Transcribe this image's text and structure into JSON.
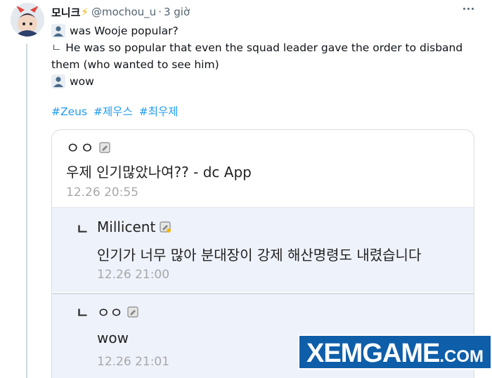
{
  "tweet": {
    "display_name": "모니크",
    "name_emoji": "⚡",
    "handle": "@mochou_u",
    "separator": "·",
    "time": "3 giờ",
    "lines": [
      {
        "icon": "person-icon",
        "text": "was Wooje popular?"
      },
      {
        "mark": "ㄴ",
        "text": "He was so popular that even the squad leader gave the order to disband them (who wanted to see him)"
      },
      {
        "icon": "person-icon",
        "text": "wow"
      }
    ],
    "hashtags": [
      "#Zeus",
      "#제우스",
      "#최우제"
    ]
  },
  "card": {
    "post": {
      "author": "ㅇㅇ",
      "text": "우제 인기많았나여?? - dc App",
      "time": "12.26 20:55"
    },
    "replies": [
      {
        "arrow": "ㄴ",
        "author": "Millicent",
        "text": "인기가 너무 많아 분대장이 강제 해산명령도 내렸습니다",
        "time": "12.26 21:00"
      },
      {
        "arrow": "ㄴ",
        "author": "ㅇㅇ",
        "text": "wow",
        "time": "12.26 21:01"
      }
    ]
  },
  "watermark": {
    "main": "XEMGAME",
    "suffix": ".COM"
  },
  "colors": {
    "link": "#1d9bf0",
    "muted": "#536471",
    "reply_bg": "#eef2fb",
    "watermark_bg": "#0e5ea9"
  }
}
